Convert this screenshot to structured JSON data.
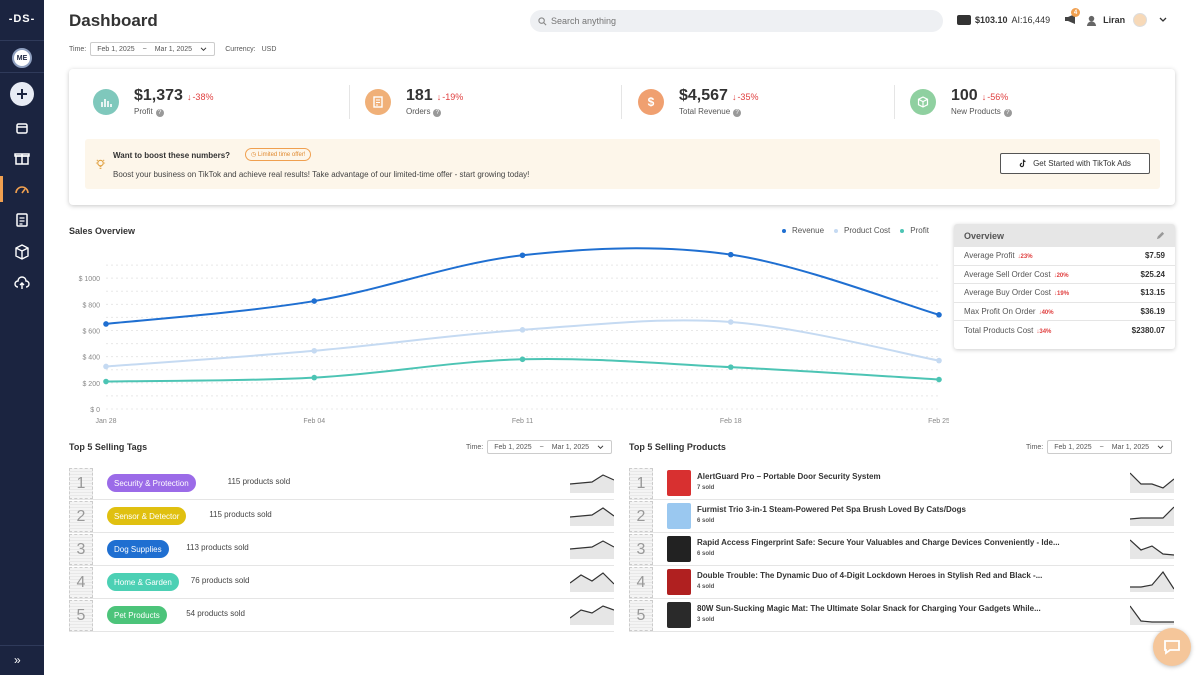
{
  "sidebar": {
    "logo": "-DS-",
    "me": "ME",
    "items": [
      "add-icon",
      "store-icon",
      "gift-icon",
      "gauge-icon",
      "document-icon",
      "box-icon",
      "cloud-upload-icon"
    ],
    "expand": "»"
  },
  "header": {
    "title": "Dashboard",
    "search_placeholder": "Search anything",
    "balance": "$103.10",
    "ai_credits": "AI:16,449",
    "notifications": "4",
    "user": "Liran"
  },
  "filters": {
    "time_label": "Time:",
    "from": "Feb 1, 2025",
    "sep": "~",
    "to": "Mar 1, 2025",
    "currency_label": "Currency:",
    "currency": "USD"
  },
  "stats": [
    {
      "value": "$1,373",
      "change": "-38%",
      "label": "Profit",
      "color": "#7fc8bc"
    },
    {
      "value": "181",
      "change": "-19%",
      "label": "Orders",
      "color": "#f0b078"
    },
    {
      "value": "$4,567",
      "change": "-35%",
      "label": "Total Revenue",
      "color": "#f0a070"
    },
    {
      "value": "100",
      "change": "-56%",
      "label": "New Products",
      "color": "#8fd0a0"
    }
  ],
  "promo": {
    "title": "Want to boost these numbers?",
    "badge": "Limited time offer!",
    "text": "Boost your business on TikTok and achieve real results! Take advantage of our limited-time offer - start growing today!",
    "button": "Get Started with TikTok Ads"
  },
  "sales": {
    "title": "Sales Overview",
    "legend": [
      "Revenue",
      "Product Cost",
      "Profit"
    ]
  },
  "chart_data": {
    "type": "line",
    "x": [
      "Jan 28",
      "Feb 04",
      "Feb 11",
      "Feb 18",
      "Feb 25"
    ],
    "x_positions_days": [
      0,
      7,
      14,
      21,
      28
    ],
    "yticks": [
      "$ 0",
      "$ 200",
      "$ 400",
      "$ 600",
      "$ 800",
      "$ 1000"
    ],
    "ylim": [
      0,
      1000
    ],
    "grid": true,
    "series": [
      {
        "name": "Revenue",
        "color": "#1f6fd1",
        "x": [
          0,
          7.5,
          15,
          22.5,
          30
        ],
        "values": [
          650,
          825,
          1175,
          1180,
          720
        ]
      },
      {
        "name": "Product Cost",
        "color": "#c5daf2",
        "x": [
          0,
          7.5,
          15,
          22.5,
          30
        ],
        "values": [
          325,
          445,
          605,
          665,
          370
        ]
      },
      {
        "name": "Profit",
        "color": "#4cc4b4",
        "x": [
          0,
          7.5,
          15,
          22.5,
          30
        ],
        "values": [
          210,
          240,
          380,
          320,
          225
        ]
      }
    ]
  },
  "overview": {
    "title": "Overview",
    "rows": [
      {
        "label": "Average Profit",
        "change": "23%",
        "value": "$7.59"
      },
      {
        "label": "Average Sell Order Cost",
        "change": "20%",
        "value": "$25.24"
      },
      {
        "label": "Average Buy Order Cost",
        "change": "19%",
        "value": "$13.15"
      },
      {
        "label": "Max Profit On Order",
        "change": "40%",
        "value": "$36.19"
      },
      {
        "label": "Total Products Cost",
        "change": "34%",
        "value": "$2380.07"
      }
    ]
  },
  "top_tags": {
    "title": "Top 5 Selling Tags",
    "time_label": "Time:",
    "from": "Feb 1, 2025",
    "to": "Mar 1, 2025",
    "rows": [
      {
        "rank": "1",
        "tag": "Security & Protection",
        "color": "#9b6be8",
        "sold": "115 products sold",
        "spark": [
          0.4,
          0.45,
          0.5,
          0.85,
          0.6
        ]
      },
      {
        "rank": "2",
        "tag": "Sensor & Detector",
        "color": "#e0c010",
        "sold": "115 products sold",
        "spark": [
          0.4,
          0.45,
          0.5,
          0.85,
          0.45
        ]
      },
      {
        "rank": "3",
        "tag": "Dog Supplies",
        "color": "#1f6fd1",
        "sold": "113 products sold",
        "spark": [
          0.45,
          0.5,
          0.55,
          0.85,
          0.55
        ]
      },
      {
        "rank": "4",
        "tag": "Home & Garden",
        "color": "#4cd0b4",
        "sold": "76 products sold",
        "spark": [
          0.4,
          0.8,
          0.5,
          0.9,
          0.35
        ]
      },
      {
        "rank": "5",
        "tag": "Pet Products",
        "color": "#4cc47a",
        "sold": "54 products sold",
        "spark": [
          0.3,
          0.7,
          0.55,
          0.9,
          0.7
        ]
      }
    ]
  },
  "top_products": {
    "title": "Top 5 Selling Products",
    "time_label": "Time:",
    "from": "Feb 1, 2025",
    "to": "Mar 1, 2025",
    "rows": [
      {
        "rank": "1",
        "name": "AlertGuard Pro – Portable Door Security System",
        "sold": "7 sold",
        "thumb": "#d83030",
        "spark": [
          0.95,
          0.4,
          0.4,
          0.2,
          0.65
        ]
      },
      {
        "rank": "2",
        "name": "Furmist Trio 3-in-1 Steam-Powered Pet Spa Brush Loved By Cats/Dogs",
        "sold": "6 sold",
        "thumb": "#9ac8f0",
        "spark": [
          0.3,
          0.35,
          0.35,
          0.35,
          0.9
        ]
      },
      {
        "rank": "3",
        "name": "Rapid Access Fingerprint Safe: Secure Your Valuables and Charge Devices Conveniently - Ide...",
        "sold": "6 sold",
        "thumb": "#222222",
        "spark": [
          0.9,
          0.4,
          0.6,
          0.2,
          0.15
        ]
      },
      {
        "rank": "4",
        "name": "Double Trouble: The Dynamic Duo of 4-Digit Lockdown Heroes in Stylish Red and Black -...",
        "sold": "4 sold",
        "thumb": "#b02020",
        "spark": [
          0.2,
          0.2,
          0.3,
          0.95,
          0.1
        ]
      },
      {
        "rank": "5",
        "name": "80W Sun-Sucking Magic Mat: The Ultimate Solar Snack for Charging Your Gadgets While...",
        "sold": "3 sold",
        "thumb": "#2a2a2a",
        "spark": [
          0.9,
          0.15,
          0.1,
          0.1,
          0.1
        ]
      }
    ]
  }
}
